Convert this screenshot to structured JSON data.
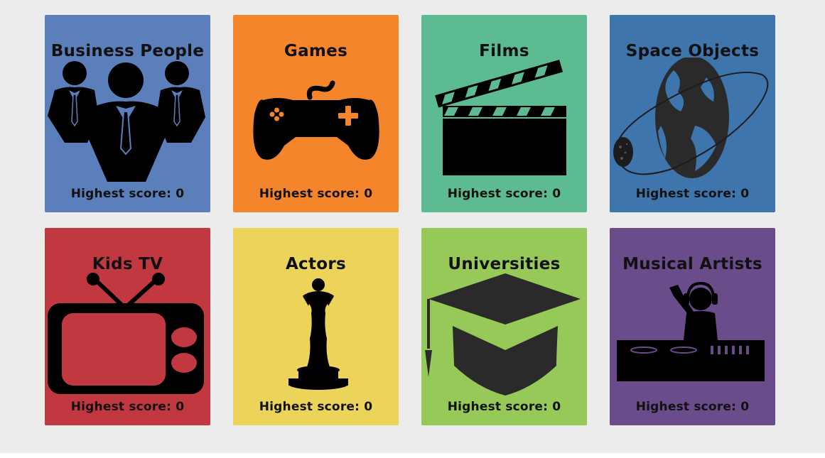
{
  "score_prefix": "Highest score: ",
  "cards": [
    {
      "title": "Business People",
      "score": "0",
      "color": "#5b7fbb",
      "icon": "business-people-icon"
    },
    {
      "title": "Games",
      "score": "0",
      "color": "#f5852a",
      "icon": "gamepad-icon"
    },
    {
      "title": "Films",
      "score": "0",
      "color": "#5cbb91",
      "icon": "clapperboard-icon"
    },
    {
      "title": "Space Objects",
      "score": "0",
      "color": "#3f75ad",
      "icon": "planet-orbit-icon"
    },
    {
      "title": "Kids TV",
      "score": "0",
      "color": "#c23841",
      "icon": "retro-tv-icon"
    },
    {
      "title": "Actors",
      "score": "0",
      "color": "#ecd45b",
      "icon": "oscar-statue-icon"
    },
    {
      "title": "Universities",
      "score": "0",
      "color": "#96c957",
      "icon": "graduation-cap-icon"
    },
    {
      "title": "Musical Artists",
      "score": "0",
      "color": "#6b4c8a",
      "icon": "dj-icon"
    }
  ]
}
